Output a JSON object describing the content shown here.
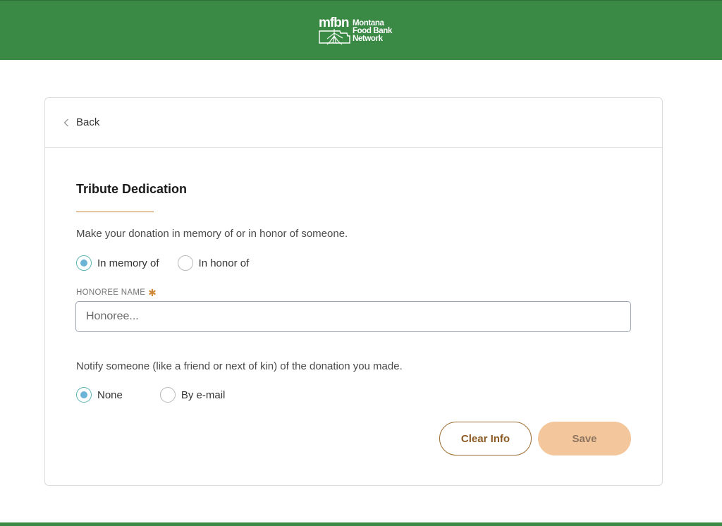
{
  "header": {
    "logo_abbr": "mfbn",
    "logo_line1": "Montana",
    "logo_line2": "Food Bank",
    "logo_line3": "Network",
    "background_color": "#3a8a45"
  },
  "back": {
    "label": "Back",
    "icon": "chevron-left-icon"
  },
  "section": {
    "title": "Tribute Dedication",
    "intro": "Make your donation in memory of or in honor of someone."
  },
  "tribute_type": {
    "options": [
      {
        "label": "In memory of",
        "checked": true
      },
      {
        "label": "In honor of",
        "checked": false
      }
    ]
  },
  "honoree": {
    "label": "HONOREE NAME",
    "required_marker": "✱",
    "placeholder": "Honoree...",
    "value": ""
  },
  "notify": {
    "text": "Notify someone (like a friend or next of kin) of the donation you made.",
    "options": [
      {
        "label": "None",
        "checked": true
      },
      {
        "label": "By e-mail",
        "checked": false
      }
    ]
  },
  "buttons": {
    "clear_label": "Clear Info",
    "save_label": "Save"
  },
  "colors": {
    "accent_orange": "#c7832f",
    "radio_selected": "#6cb4d6",
    "save_bg": "#f3c69c"
  }
}
